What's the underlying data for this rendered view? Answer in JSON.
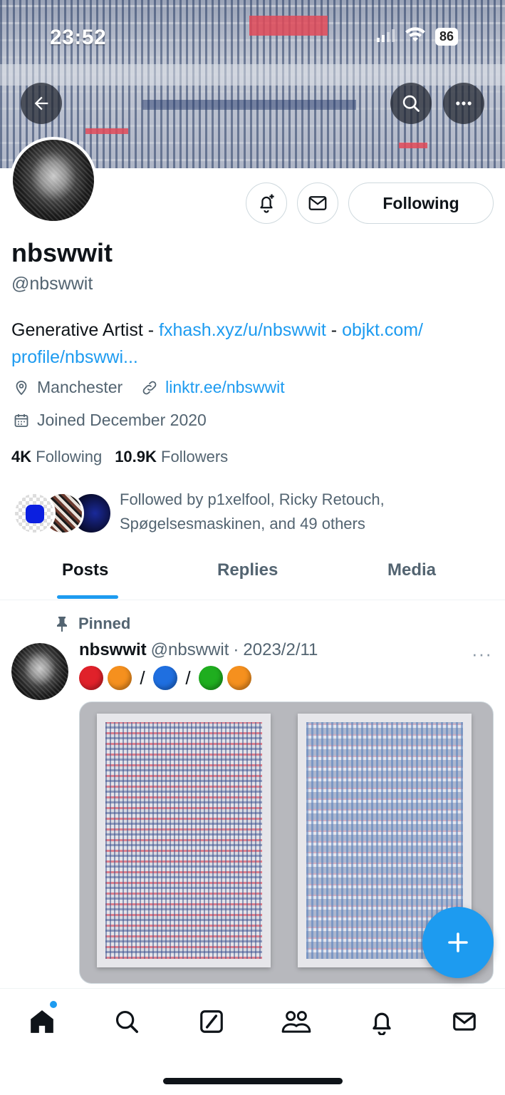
{
  "status_bar": {
    "time": "23:52",
    "battery": "86"
  },
  "profile": {
    "display_name": "nbswwit",
    "handle": "@nbswwit",
    "follow_button_label": "Following",
    "bio_prefix": "Generative Artist - ",
    "bio_link1": "fxhash.xyz/u/nbswwit",
    "bio_sep": " - ",
    "bio_link2": "objkt.com/ profile/nbswwi...",
    "location": "Manchester",
    "website": "linktr.ee/nbswwit",
    "joined": "Joined December 2020",
    "following_count": "4K",
    "following_label": "Following",
    "followers_count": "10.9K",
    "followers_label": "Followers",
    "followed_by": "Followed by p1xelfool, Ricky Retouch, Spøgelsesmaskinen, and 49 others"
  },
  "tabs": [
    {
      "label": "Posts"
    },
    {
      "label": "Replies"
    },
    {
      "label": "Media"
    }
  ],
  "pinned_post": {
    "pinned_label": "Pinned",
    "author_name": "nbswwit",
    "author_handle": "@nbswwit",
    "separator": "·",
    "date": "2023/2/11",
    "more": "···",
    "text_sep": "/",
    "emoji_colors": [
      "#e0212a",
      "#f5901e",
      "#1f6fe0",
      "#1fae1f",
      "#f5901e"
    ]
  },
  "colors": {
    "accent": "#1d9bf0",
    "text": "#0f1419",
    "muted": "#536471"
  },
  "nav": [
    "home-icon",
    "search-icon",
    "grok-icon",
    "communities-icon",
    "notifications-icon",
    "messages-icon"
  ]
}
